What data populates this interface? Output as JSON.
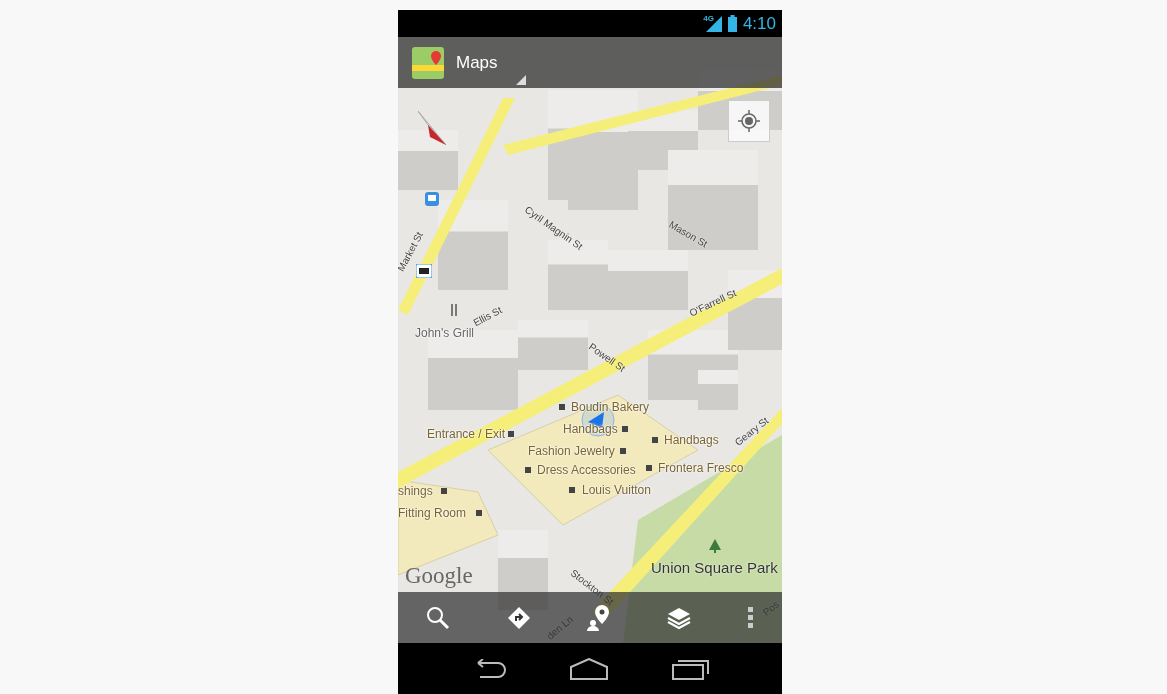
{
  "status_bar": {
    "network": "4G",
    "time": "4:10"
  },
  "action_bar": {
    "title": "Maps"
  },
  "map": {
    "places": [
      {
        "text": "John's Grill",
        "kind": "restaurant"
      },
      {
        "text": "Boudin Bakery",
        "kind": "poi"
      },
      {
        "text": "Handbags",
        "kind": "poi"
      },
      {
        "text": "Handbags",
        "kind": "poi"
      },
      {
        "text": "Entrance / Exit",
        "kind": "poi"
      },
      {
        "text": "Fashion Jewelry",
        "kind": "poi"
      },
      {
        "text": "Dress Accessories",
        "kind": "poi"
      },
      {
        "text": "Frontera Fresco",
        "kind": "poi"
      },
      {
        "text": "Louis Vuitton",
        "kind": "poi"
      },
      {
        "text": "shings",
        "kind": "poi"
      },
      {
        "text": "Fitting Room",
        "kind": "poi"
      }
    ],
    "streets": [
      "Market St",
      "Cyril Magnin St",
      "Mason St",
      "Ellis St",
      "O'Farrell St",
      "Powell St",
      "Geary St",
      "Stockton St",
      "den Ln",
      "Pos"
    ],
    "park": "Union Square Park",
    "attribution": "Google"
  }
}
